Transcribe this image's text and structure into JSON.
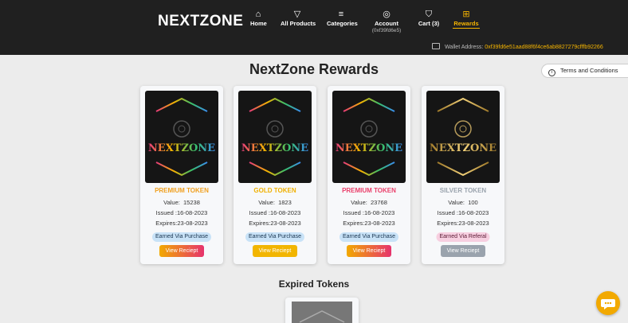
{
  "brand": {
    "name": "NEXTZONE"
  },
  "nav": [
    {
      "label": "Home",
      "icon": "home-icon",
      "sub": ""
    },
    {
      "label": "All Products",
      "icon": "filter-icon",
      "sub": ""
    },
    {
      "label": "Categories",
      "icon": "list-icon",
      "sub": ""
    },
    {
      "label": "Account",
      "icon": "user-icon",
      "sub": "(0xf39fd6e5)"
    },
    {
      "label": "Cart (3)",
      "icon": "bag-icon",
      "sub": ""
    },
    {
      "label": "Rewards",
      "icon": "gift-icon",
      "sub": "",
      "active": true
    }
  ],
  "wallet": {
    "label": "Wallet Address:",
    "value": "0xf39fd6e51aad88f6f4ce6ab8827279cfffb92266"
  },
  "page": {
    "title": "NextZone Rewards",
    "terms_label": "Terms and Conditions"
  },
  "tokens": [
    {
      "name": "PREMIUM TOKEN",
      "value_label": "Value:",
      "value": "15238",
      "issued_label": "Issued :",
      "issued": "16-08-2023",
      "expires_label": "Expires:",
      "expires": "23-08-2023",
      "earned": "Earned Via Purchase",
      "earned_type": "purchase",
      "button": "View Reciept",
      "name_color": "#f0a020",
      "button_color": "#e9504a",
      "image_text": "NEXTZONE"
    },
    {
      "name": "GOLD TOKEN",
      "value_label": "Value:",
      "value": "1823",
      "issued_label": "Issued :",
      "issued": "16-08-2023",
      "expires_label": "Expires:",
      "expires": "23-08-2023",
      "earned": "Earned Via Purchase",
      "earned_type": "purchase",
      "button": "View Reciept",
      "name_color": "#f0b000",
      "button_color": "#f2b500",
      "image_text": "NEXTZONE"
    },
    {
      "name": "PREMIUM TOKEN",
      "value_label": "Value:",
      "value": "23768",
      "issued_label": "Issued :",
      "issued": "16-08-2023",
      "expires_label": "Expires:",
      "expires": "23-08-2023",
      "earned": "Earned Via Purchase",
      "earned_type": "purchase",
      "button": "View Reciept",
      "name_color": "#f0a020",
      "button_color": "#e9504a",
      "image_text": "NEXTZONE"
    },
    {
      "name": "SILVER TOKEN",
      "value_label": "Value:",
      "value": "100",
      "issued_label": "Issued :",
      "issued": "16-08-2023",
      "expires_label": "Expires:",
      "expires": "23-08-2023",
      "earned": "Earned Via Referal",
      "earned_type": "referal",
      "button": "View Reciept",
      "name_color": "#9aa3ad",
      "button_color": "#9aa3ad",
      "image_text": "NEXTZONE"
    }
  ],
  "expired": {
    "title": "Expired Tokens"
  }
}
